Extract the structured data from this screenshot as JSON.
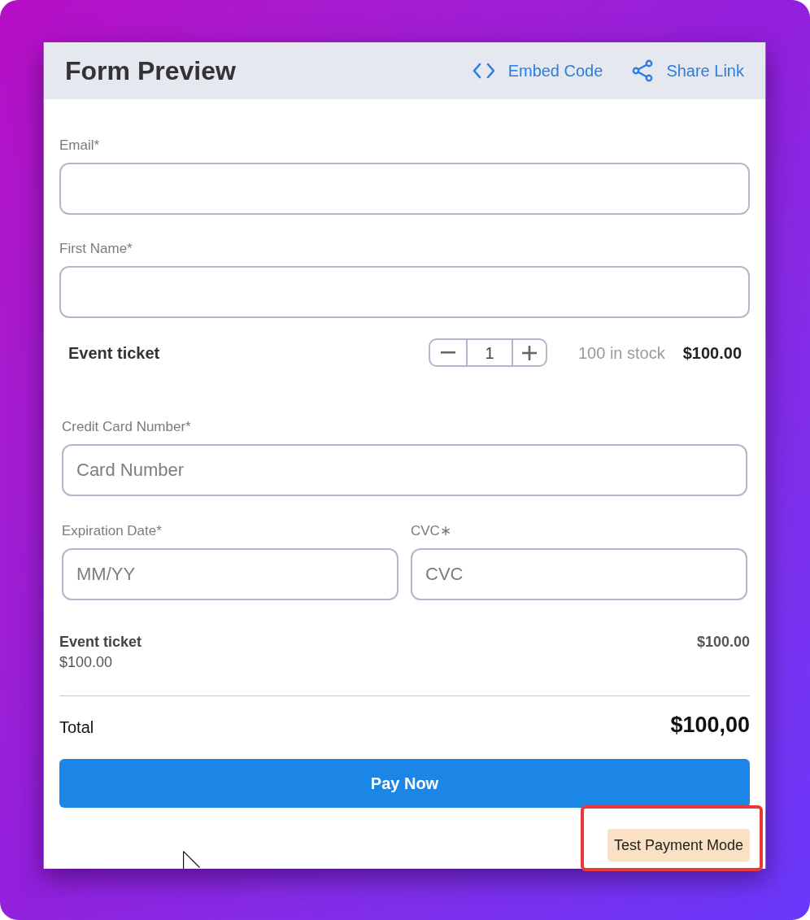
{
  "header": {
    "title": "Form Preview",
    "actions": [
      {
        "kind": "embed",
        "label": "Embed Code"
      },
      {
        "kind": "share",
        "label": "Share Link"
      }
    ]
  },
  "fields": [
    {
      "label": "Email*"
    },
    {
      "label": "First Name*"
    }
  ],
  "product": {
    "name": "Event ticket",
    "quantity": "1",
    "stock": "100 in stock",
    "price": "$100.00"
  },
  "payment": {
    "card_number": {
      "label": "Credit Card Number*",
      "placeholder": "Card Number"
    },
    "expiration": {
      "label": "Expiration Date*",
      "placeholder": "MM/YY"
    },
    "cvc": {
      "label": "CVC∗",
      "placeholder": "CVC"
    }
  },
  "summary": {
    "items": [
      {
        "name": "Event ticket",
        "unit_price": "$100.00",
        "amount": "$100.00"
      }
    ],
    "total_label": "Total",
    "total": "$100,00"
  },
  "pay_button": "Pay Now",
  "test_mode": {
    "label": "Test Payment Mode",
    "highlighted": true
  }
}
